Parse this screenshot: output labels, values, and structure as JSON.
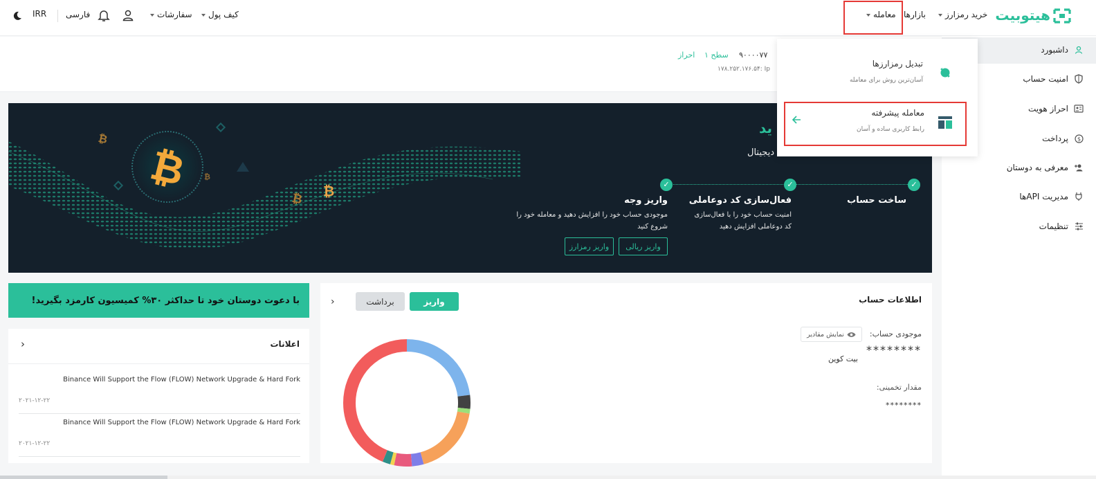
{
  "colors": {
    "accent": "#2bbf9a",
    "highlight": "#e53935",
    "banner_bg": "#14202b"
  },
  "topnav": {
    "logo_text": "هیتوبیت",
    "buy_crypto": "خرید رمزارز",
    "markets": "بازارها",
    "trade": "معامله",
    "wallet": "کیف پول",
    "orders": "سفارشات",
    "language": "فارسی",
    "currency": "IRR"
  },
  "dropdown": {
    "items": [
      {
        "title": "تبدیل رمزارزها",
        "subtitle": "آسان‌ترین روش برای معامله",
        "icon": "convert-icon"
      },
      {
        "title": "معامله پیشرفته",
        "subtitle": "رابط کاربری ساده و آسان",
        "icon": "layout-icon"
      }
    ]
  },
  "sidebar": {
    "items": [
      {
        "label": "داشبورد",
        "icon": "user-icon"
      },
      {
        "label": "امنیت حساب",
        "icon": "shield-icon"
      },
      {
        "label": "احراز هویت",
        "icon": "id-card-icon"
      },
      {
        "label": "پرداخت",
        "icon": "payment-icon"
      },
      {
        "label": "معرفی به دوستان",
        "icon": "add-user-icon"
      },
      {
        "label": "مدیریت APIها",
        "icon": "plug-icon"
      },
      {
        "label": "تنظیمات",
        "icon": "sliders-icon"
      }
    ]
  },
  "userbar": {
    "user_id_fragment": "۹۰۰۰۰۷۷",
    "level": "سطح ۱",
    "verify": "احراز",
    "ip_fragment": "۱۷۸.۲۵۲.۱۷۶.۵۴: Ip"
  },
  "banner": {
    "headline_fragment": "ید",
    "sub_fragment": "دیجیتال",
    "steps": [
      {
        "title": "ساخت حساب",
        "desc": ""
      },
      {
        "title": "فعال‌سازی کد دوعاملی",
        "desc": "امنیت حساب خود را با فعال‌سازی کد دوعاملی افزایش دهید"
      },
      {
        "title": "واریز وجه",
        "desc": "موجودی حساب خود را افزایش دهید و معامله خود را شروع کنید"
      }
    ],
    "deposit_rial": "واریز ریالی",
    "deposit_crypto": "واریز رمزارز"
  },
  "account": {
    "title": "اطلاعات حساب",
    "deposit": "واریز",
    "withdraw": "برداشت",
    "balance_label": "موجودی حساب:",
    "show_values": "نمایش مقادیر",
    "balance_masked": "********",
    "balance_unit": "بیت کوین",
    "estimate_label": "مقدار تخمینی:",
    "estimate_masked": "********"
  },
  "promo": {
    "text": "با دعوت دوستان خود تا حداکثر ۳۰% کمیسیون کارمزد بگیرید!"
  },
  "notices": {
    "title": "اعلانات",
    "items": [
      {
        "title": "Binance Will Support the Flow (FLOW) Network Upgrade & Hard Fork",
        "date": "۲۰۲۱-۱۲-۲۲"
      },
      {
        "title": "Binance Will Support the Flow (FLOW) Network Upgrade & Hard Fork",
        "date": "۲۰۲۱-۱۲-۲۲"
      }
    ]
  },
  "donut": {
    "segments": [
      {
        "color": "#7db4ec",
        "value": 23
      },
      {
        "color": "#424242",
        "value": 3.5
      },
      {
        "color": "#9be07a",
        "value": 1.2
      },
      {
        "color": "#f6a15a",
        "value": 18
      },
      {
        "color": "#7e7ee8",
        "value": 3
      },
      {
        "color": "#e85a7d",
        "value": 4.5
      },
      {
        "color": "#f2d34f",
        "value": 1
      },
      {
        "color": "#2f8f88",
        "value": 2
      },
      {
        "color": "#f25c5c",
        "value": 43.8
      }
    ]
  }
}
